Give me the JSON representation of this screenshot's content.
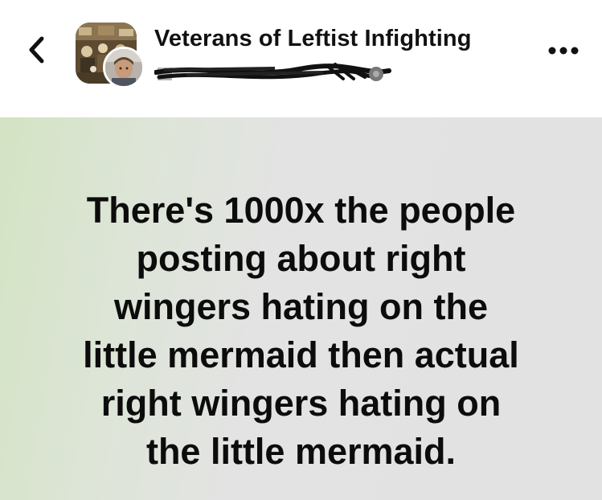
{
  "header": {
    "group_name": "Veterans of Leftist Infighting",
    "back_icon": "chevron-left-icon",
    "more_icon": "more-horizontal-icon"
  },
  "post": {
    "text": "There's 1000x the people\nposting about right\nwingers hating on the\nlittle mermaid then actual\nright wingers hating on\nthe little mermaid.",
    "background_gradient_start": "#d3e3c3",
    "background_gradient_end": "#e2e2e2"
  }
}
